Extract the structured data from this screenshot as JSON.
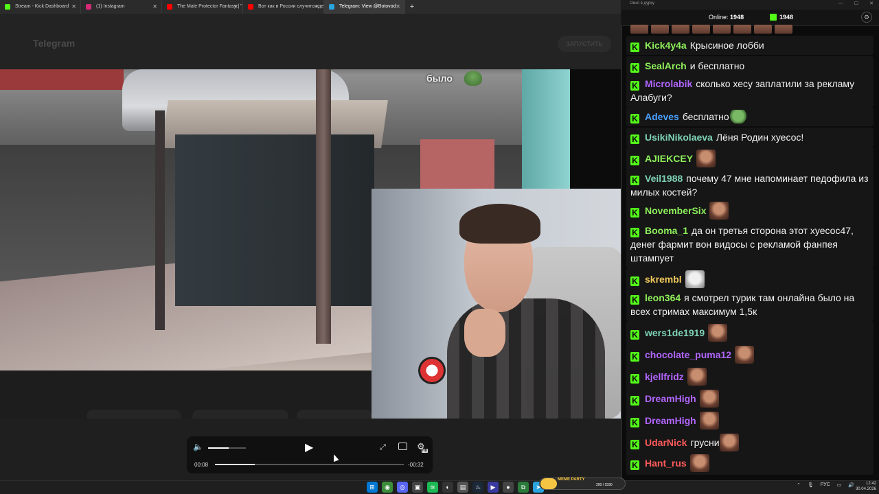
{
  "browser": {
    "tabs": [
      {
        "label": "Stream - Kick Dashboard",
        "color": "#53fc18"
      },
      {
        "label": "(1) Instagram",
        "color": "#d62976"
      },
      {
        "label": "The Male Protector Fantasy | \"S...",
        "color": "#ff0000"
      },
      {
        "label": "Вот как в России случится дев...",
        "color": "#ff0000"
      },
      {
        "label": "Telegram: View @Botovod",
        "color": "#2aa3df"
      }
    ],
    "active_tab": 4,
    "new_tab": "+"
  },
  "telegram": {
    "title": "Telegram",
    "header_button": "ЗАПУСТИТЬ"
  },
  "video": {
    "overlay_text": "было"
  },
  "player": {
    "current_time": "00:08",
    "remaining_time": "-00:32",
    "progress_fraction": 0.21,
    "volume_fraction": 0.55,
    "hd_label": "HD"
  },
  "chat": {
    "window_title": "Окно в дурку",
    "online_label": "Online:",
    "online_count": "1948",
    "kick_count": "1948",
    "colors": {
      "kick_green": "#53fc18",
      "bg": "#0b0b0b"
    },
    "messages": [
      {
        "user": "Kick4y4a",
        "color": "#8ef05a",
        "text": "Крысиное лобби"
      },
      {
        "user": "SealArch",
        "color": "#8ef05a",
        "text": "и бесплатно"
      },
      {
        "user": "Microlabik",
        "color": "#b266ff",
        "text": "сколько хесу заплатили за рекламу Алабуги?"
      },
      {
        "user": "Adeves",
        "color": "#4aa0ff",
        "text": "бесплатно",
        "emote": "frog"
      },
      {
        "user": "UsikiNikolaeva",
        "color": "#7ed3b5",
        "text": "Лёня Родин хуесос!"
      },
      {
        "user": "AJIEKCEY",
        "color": "#8ef05a",
        "text": "",
        "emote": "face"
      },
      {
        "user": "Veil1988",
        "color": "#7ed3b5",
        "text": "почему 47 мне напоминает педофила из милых костей?"
      },
      {
        "user": "NovemberSix",
        "color": "#8ef05a",
        "text": "",
        "emote": "face"
      },
      {
        "user": "Booma_1",
        "color": "#8ef05a",
        "text": "да он третья сторона этот хуесос47, денег фармит вон видосы с рекламой фанпея штампует"
      },
      {
        "user": "skrembl",
        "color": "#f0c85a",
        "text": "",
        "emote": "rat"
      },
      {
        "user": "leon364",
        "color": "#8ef05a",
        "text": "я смотрел турик там онлайна было на всех стримах максимум 1,5к"
      },
      {
        "user": "wers1de1919",
        "color": "#7ed3b5",
        "text": "",
        "emote": "face"
      },
      {
        "user": "chocolate_puma12",
        "color": "#b266ff",
        "text": "",
        "emote": "face"
      },
      {
        "user": "kjellfridz",
        "color": "#b266ff",
        "text": "",
        "emote": "face"
      },
      {
        "user": "DreamHigh",
        "color": "#b266ff",
        "text": "",
        "emote": "face"
      },
      {
        "user": "DreamHigh",
        "color": "#b266ff",
        "text": "",
        "emote": "face"
      },
      {
        "user": "UdarNick",
        "color": "#ff5a5a",
        "text": "грусни",
        "emote": "face"
      },
      {
        "user": "Hant_rus",
        "color": "#ff5a5a",
        "text": "",
        "emote": "face"
      }
    ]
  },
  "taskbar": {
    "meme_party_title": "MEME PARTY",
    "meme_party_count": "200 / 1590",
    "tray_lang": "РУС",
    "clock_time": "12:42",
    "clock_date": "30.04.2026"
  }
}
